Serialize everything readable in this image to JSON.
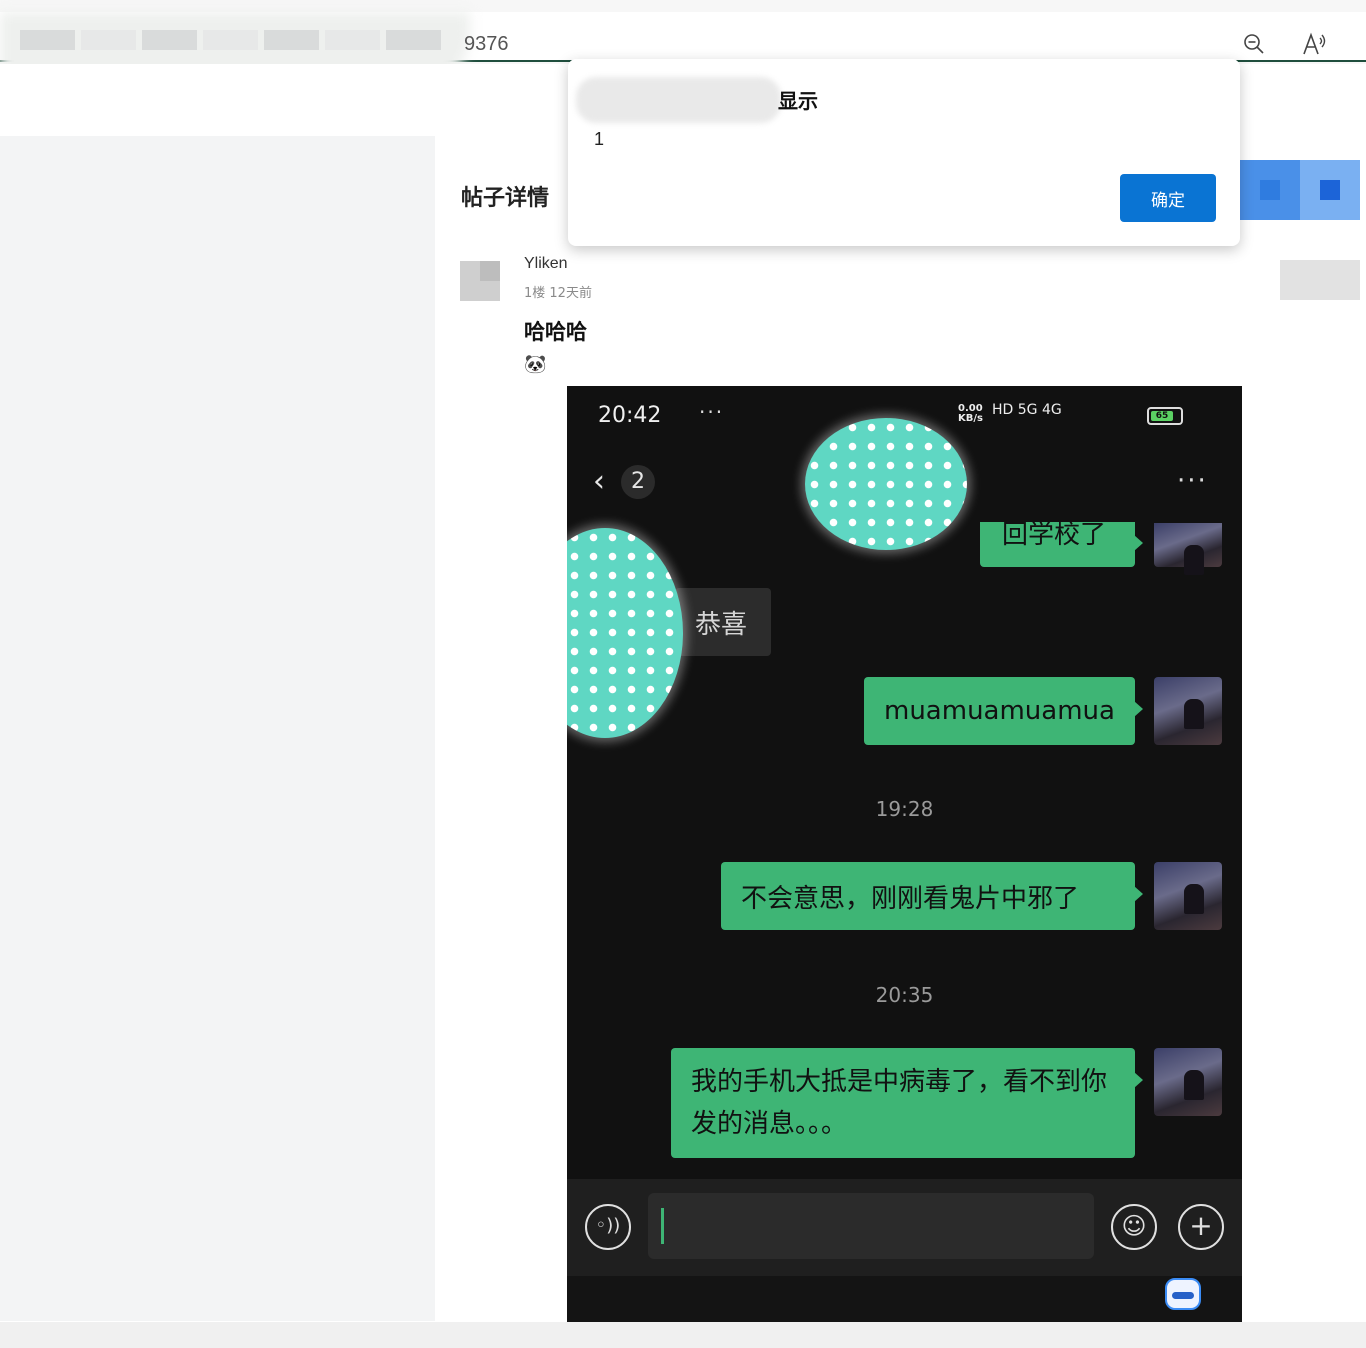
{
  "browser": {
    "address_visible_text": "9376",
    "zoom_icon": "zoom-out-icon",
    "read_aloud_icon": "read-aloud-icon"
  },
  "post": {
    "section_title": "帖子详情",
    "author": "Yliken",
    "meta": "1楼  12天前",
    "title": "哈哈哈",
    "emoji": "🐼"
  },
  "phone": {
    "status_time": "20:42",
    "status_dots": "···",
    "network_speed": "0.00\nKB/s",
    "signal": "HD 5G 4G",
    "battery": "65",
    "back_badge": "2",
    "more": "···",
    "messages": [
      {
        "type": "out",
        "text": "回学校了"
      },
      {
        "type": "in",
        "text": "恭喜"
      },
      {
        "type": "out",
        "text": "muamuamuamua"
      },
      {
        "type": "time",
        "text": "19:28"
      },
      {
        "type": "out",
        "text": "不会意思，刚刚看鬼片中邪了"
      },
      {
        "type": "time",
        "text": "20:35"
      },
      {
        "type": "out",
        "text": "我的手机大抵是中病毒了，看不到你发的消息。。。"
      }
    ]
  },
  "dialog": {
    "title": "显示",
    "message": "1",
    "ok_label": "确定"
  }
}
